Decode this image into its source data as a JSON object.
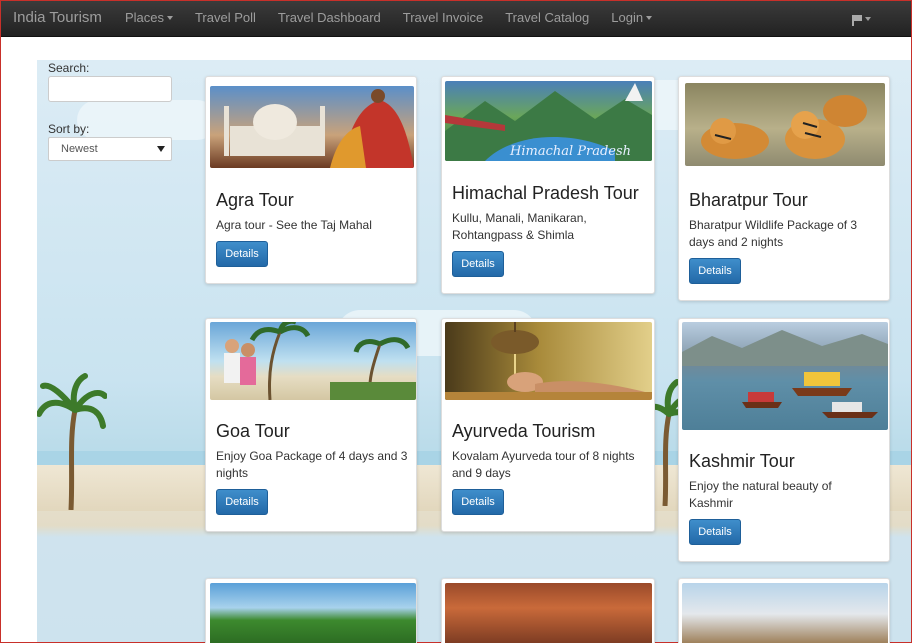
{
  "nav": {
    "brand": "India Tourism",
    "items": [
      {
        "label": "Places",
        "dropdown": true
      },
      {
        "label": "Travel Poll",
        "dropdown": false
      },
      {
        "label": "Travel Dashboard",
        "dropdown": false
      },
      {
        "label": "Travel Invoice",
        "dropdown": false
      },
      {
        "label": "Travel Catalog",
        "dropdown": false
      },
      {
        "label": "Login",
        "dropdown": true
      }
    ],
    "flag_icon": "flag-icon"
  },
  "sidebar": {
    "search_label": "Search:",
    "search_value": "",
    "sort_label": "Sort by:",
    "sort_selected": "Newest"
  },
  "tours": [
    {
      "title": "Agra Tour",
      "desc": "Agra tour - See the Taj Mahal",
      "button": "Details"
    },
    {
      "title": "Himachal Pradesh Tour",
      "desc": "Kullu, Manali, Manikaran, Rohtangpass & Shimla",
      "button": "Details",
      "image_caption": "Himachal Pradesh"
    },
    {
      "title": "Bharatpur Tour",
      "desc": "Bharatpur Wildlife Package of 3 days and 2 nights",
      "button": "Details"
    },
    {
      "title": "Goa Tour",
      "desc": "Enjoy Goa Package of 4 days and 3 nights",
      "button": "Details"
    },
    {
      "title": "Ayurveda Tourism",
      "desc": "Kovalam Ayurveda tour of 8 nights and 9 days",
      "button": "Details"
    },
    {
      "title": "Kashmir Tour",
      "desc": "Enjoy the natural beauty of Kashmir",
      "button": "Details"
    }
  ],
  "colors": {
    "navbar": "#2b2b2b",
    "nav_text": "#9d9d9d",
    "button": "#2f7dbf",
    "page_border": "#c8302a"
  }
}
